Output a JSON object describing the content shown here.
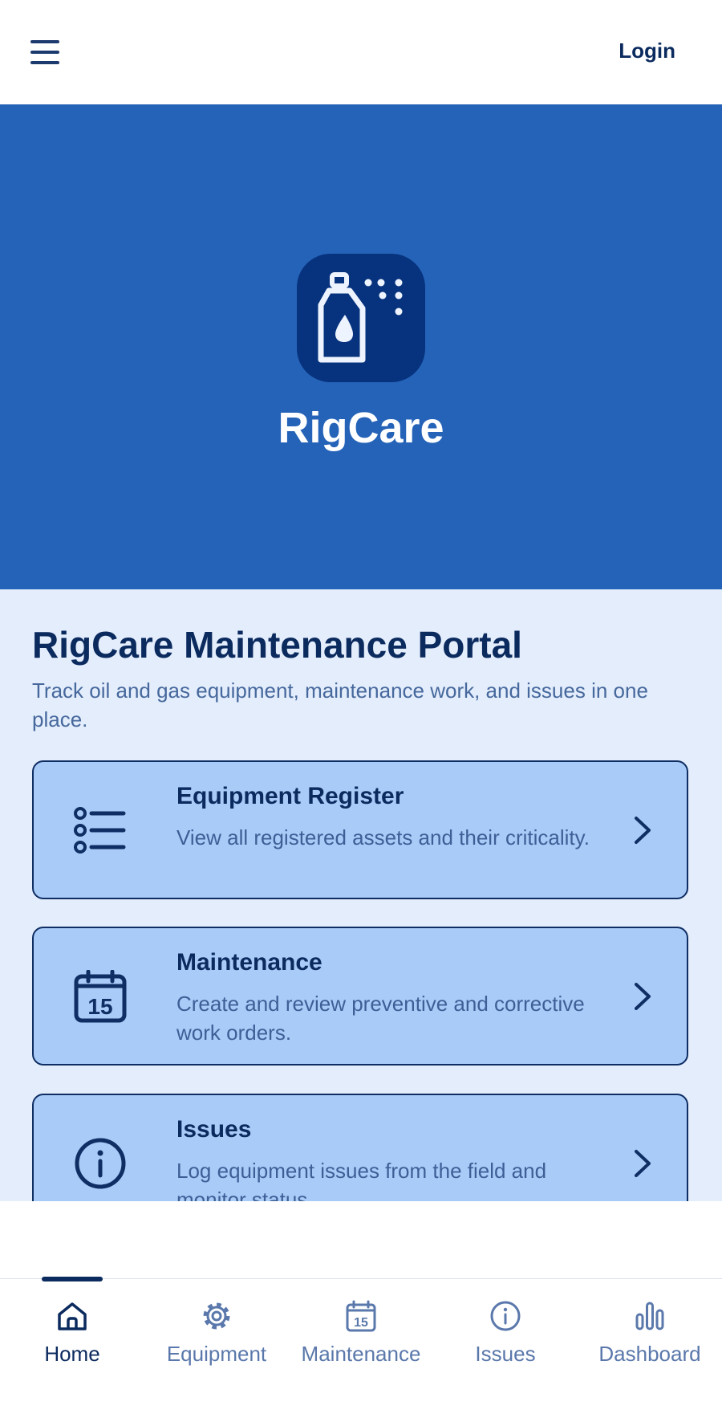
{
  "header": {
    "login_label": "Login",
    "menu_icon": "hamburger-menu-icon"
  },
  "hero": {
    "app_name": "RigCare",
    "logo_icon": "spray-bottle-icon",
    "logo_bg": "#07337e",
    "bg_color": "#2563b8"
  },
  "main": {
    "title": "RigCare Maintenance Portal",
    "subtitle": "Track oil and gas equipment, maintenance work, and issues in one place.",
    "cards": [
      {
        "icon": "list-icon",
        "title": "Equipment Register",
        "description": "View all registered assets and their criticality."
      },
      {
        "icon": "calendar-icon",
        "title": "Maintenance",
        "description": "Create and review preventive and corrective work orders."
      },
      {
        "icon": "info-icon",
        "title": "Issues",
        "description": "Log equipment issues from the field and monitor status."
      }
    ]
  },
  "bottom_nav": {
    "active": "Home",
    "items": [
      {
        "label": "Home",
        "icon": "home-icon"
      },
      {
        "label": "Equipment",
        "icon": "gear-icon"
      },
      {
        "label": "Maintenance",
        "icon": "calendar-icon"
      },
      {
        "label": "Issues",
        "icon": "info-icon"
      },
      {
        "label": "Dashboard",
        "icon": "bar-chart-icon"
      }
    ]
  },
  "colors": {
    "primary_dark": "#0b2a5e",
    "card_bg": "#a9cbf8",
    "page_bg": "#e3edfc",
    "muted_text": "#5a78ab"
  }
}
